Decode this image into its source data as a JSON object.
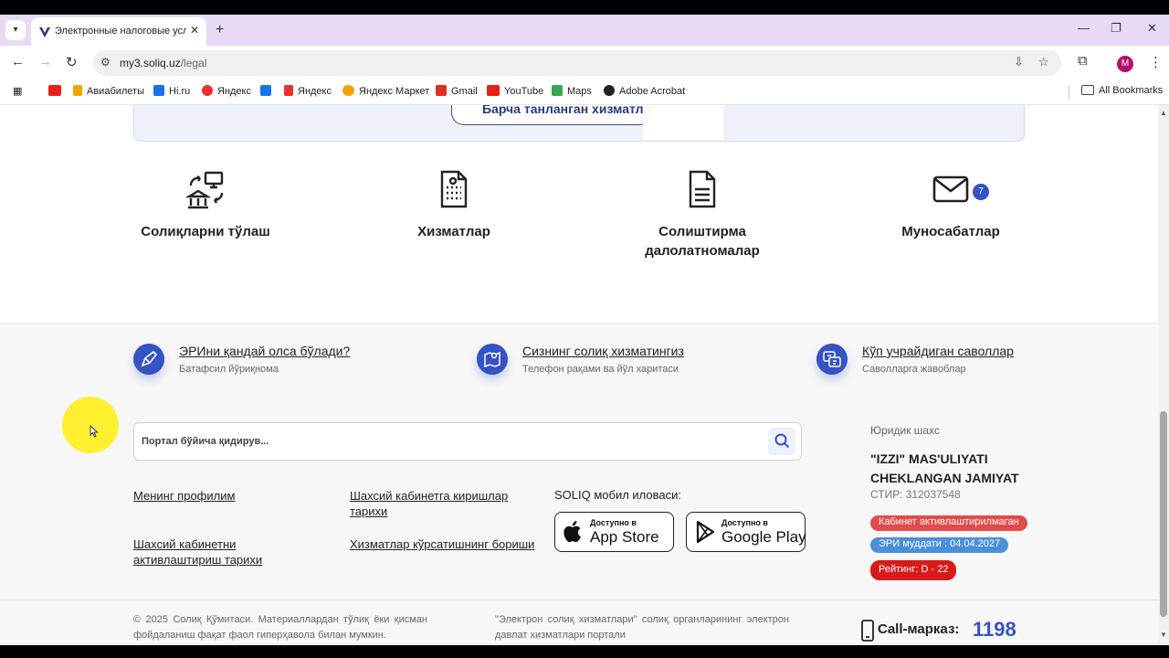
{
  "browser": {
    "tab_title": "Электронные налоговые услуги",
    "url_host": "my3.soliq.uz",
    "url_path": "/legal",
    "profile_initial": "M",
    "bookmarks": [
      {
        "label": "",
        "icon": "youtube-icon",
        "color": "#e62117"
      },
      {
        "label": "Авиабилеты",
        "icon": "plane-icon",
        "color": "#f4a300"
      },
      {
        "label": "Hi.ru",
        "icon": "hi-icon",
        "color": "#1a73e8"
      },
      {
        "label": "Яндекс",
        "icon": "yandex-icon",
        "color": "#e8322c"
      },
      {
        "label": "",
        "icon": "me-icon",
        "color": "#1a73e8"
      },
      {
        "label": "Яндекс",
        "icon": "yandex-icon",
        "color": "#e8322c"
      },
      {
        "label": "Яндекс Маркет",
        "icon": "market-icon",
        "color": "#f4a300"
      },
      {
        "label": "Gmail",
        "icon": "gmail-icon",
        "color": "#d93025"
      },
      {
        "label": "YouTube",
        "icon": "youtube-icon",
        "color": "#e62117"
      },
      {
        "label": "Maps",
        "icon": "maps-icon",
        "color": "#34a853"
      },
      {
        "label": "Adobe Acrobat",
        "icon": "acrobat-icon",
        "color": "#222222"
      }
    ],
    "all_bookmarks": "All Bookmarks"
  },
  "topcard": {
    "button_label": "Барча танланган хизматла"
  },
  "services": [
    {
      "label": "Солиқларни тўлаш",
      "icon": "bank-transfer-icon"
    },
    {
      "label": "Хизматлар",
      "icon": "document-list-icon"
    },
    {
      "label": "Солиштирма далолатномалар",
      "icon": "document-icon"
    },
    {
      "label": "Муносабатлар",
      "icon": "mail-icon",
      "badge": "7"
    }
  ],
  "info_links": [
    {
      "title": "ЭРИни қандай олса бўлади?",
      "subtitle": "Батафсил йўриқнома",
      "icon": "pen-icon"
    },
    {
      "title": "Сизнинг солиқ хизматингиз",
      "subtitle": "Телефон рақами ва йўл харитаси",
      "icon": "map-pin-icon"
    },
    {
      "title": "Кўп учрайдиган саволлар",
      "subtitle": "Саволларга жавоблар",
      "icon": "chat-question-icon"
    }
  ],
  "search": {
    "placeholder": "Портал бўйича қидирув..."
  },
  "footer_links": [
    "Менинг профилим",
    "Шахсий кабинетга киришлар тарихи",
    "Шахсий кабинетни активлаштириш тарихи",
    "Хизматлар кўрсатишнинг бориши"
  ],
  "mobile": {
    "label": "SOLIQ мобил иловаси:",
    "app_store_small": "Доступно в",
    "app_store_big": "App Store",
    "google_small": "Доступно в",
    "google_big": "Google Play"
  },
  "entity": {
    "type": "Юридик шахс",
    "name": "\"IZZI\" MAS'ULIYATI CHEKLANGAN JAMIYAT",
    "tin": "СТИР: 312037548",
    "tags": [
      {
        "label": "Кабинет активлаштирилмаган",
        "color": "#e04b4b"
      },
      {
        "label": "ЭРИ муддати : 04.04.2027",
        "color": "#4a8fd8"
      },
      {
        "label": "Рейтинг: D - 22",
        "color": "#d91a1a"
      }
    ]
  },
  "copyright": "© 2025 Солиқ Қўмитаси. Материаллардан тўлиқ ёки қисман фойдаланиш фақат фаол гиперҳавола билан мумкин.",
  "portal_note": "\"Электрон солиқ хизматлари\" солиқ органларининг электрон давлат хизматлари портали",
  "call_center": {
    "label": "Call-марказ:",
    "number": "1198"
  }
}
